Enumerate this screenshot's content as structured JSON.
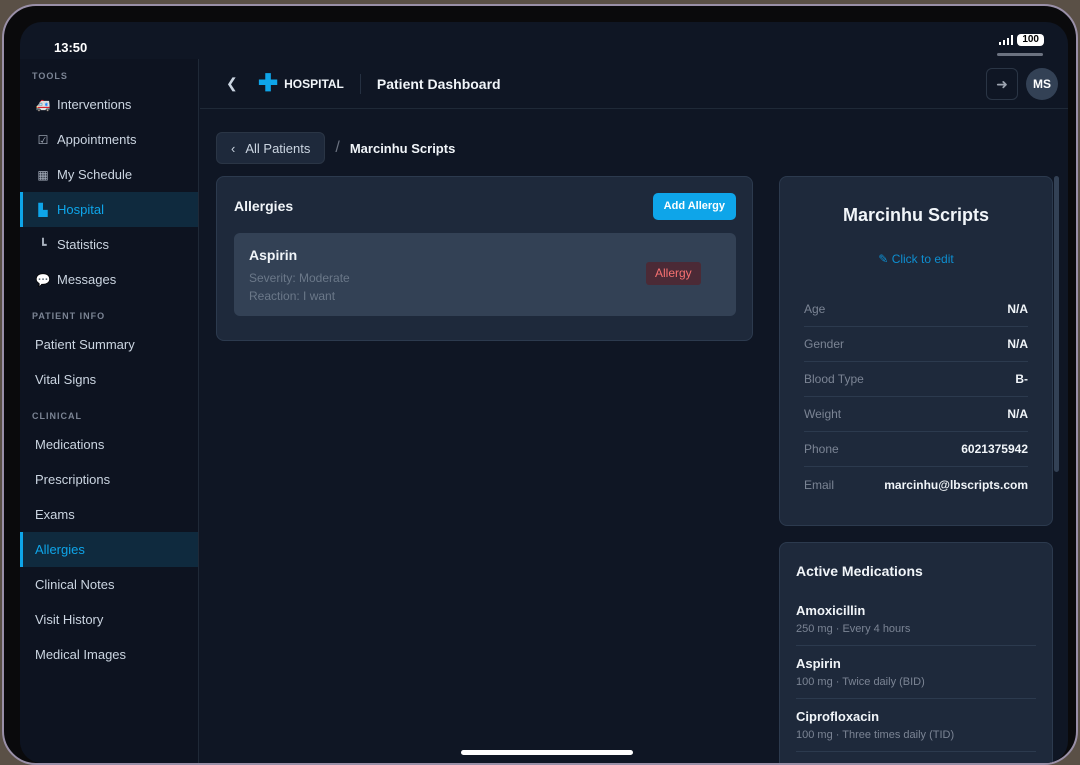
{
  "status": {
    "time": "13:50",
    "battery": "100"
  },
  "sidebar": {
    "sections": [
      {
        "title": "TOOLS",
        "items": [
          {
            "label": "Interventions",
            "icon": "ambulance-icon"
          },
          {
            "label": "Appointments",
            "icon": "calendar-check-icon"
          },
          {
            "label": "My Schedule",
            "icon": "calendar-icon"
          },
          {
            "label": "Hospital",
            "icon": "hospital-icon",
            "active": true
          },
          {
            "label": "Statistics",
            "icon": "chart-icon"
          },
          {
            "label": "Messages",
            "icon": "comments-icon"
          }
        ]
      },
      {
        "title": "PATIENT INFO",
        "items": [
          {
            "label": "Patient Summary"
          },
          {
            "label": "Vital Signs"
          }
        ]
      },
      {
        "title": "CLINICAL",
        "items": [
          {
            "label": "Medications"
          },
          {
            "label": "Prescriptions"
          },
          {
            "label": "Exams"
          },
          {
            "label": "Allergies",
            "active": true
          },
          {
            "label": "Clinical Notes"
          },
          {
            "label": "Visit History"
          },
          {
            "label": "Medical Images"
          }
        ]
      }
    ]
  },
  "header": {
    "brand": "HOSPITAL",
    "title": "Patient Dashboard",
    "avatar": "MS"
  },
  "breadcrumb": {
    "back": "All Patients",
    "current": "Marcinhu Scripts"
  },
  "allergies": {
    "title": "Allergies",
    "add": "Add Allergy",
    "items": [
      {
        "name": "Aspirin",
        "severity": "Severity: Moderate",
        "reaction": "Reaction: I want",
        "badge": "Allergy"
      }
    ]
  },
  "profile": {
    "name": "Marcinhu Scripts",
    "edit": "Click to edit",
    "fields": [
      {
        "label": "Age",
        "value": "N/A"
      },
      {
        "label": "Gender",
        "value": "N/A"
      },
      {
        "label": "Blood Type",
        "value": "B-"
      },
      {
        "label": "Weight",
        "value": "N/A"
      },
      {
        "label": "Phone",
        "value": "6021375942"
      },
      {
        "label": "Email",
        "value": "marcinhu@lbscripts.com"
      }
    ]
  },
  "medications": {
    "title": "Active Medications",
    "items": [
      {
        "name": "Amoxicillin",
        "detail": "250 mg · Every 4 hours"
      },
      {
        "name": "Aspirin",
        "detail": "100 mg · Twice daily (BID)"
      },
      {
        "name": "Ciprofloxacin",
        "detail": "100 mg · Three times daily (TID)"
      }
    ]
  },
  "colors": {
    "accent": "#0ea5e9",
    "bg": "#0f1624",
    "card": "#1e293b"
  }
}
